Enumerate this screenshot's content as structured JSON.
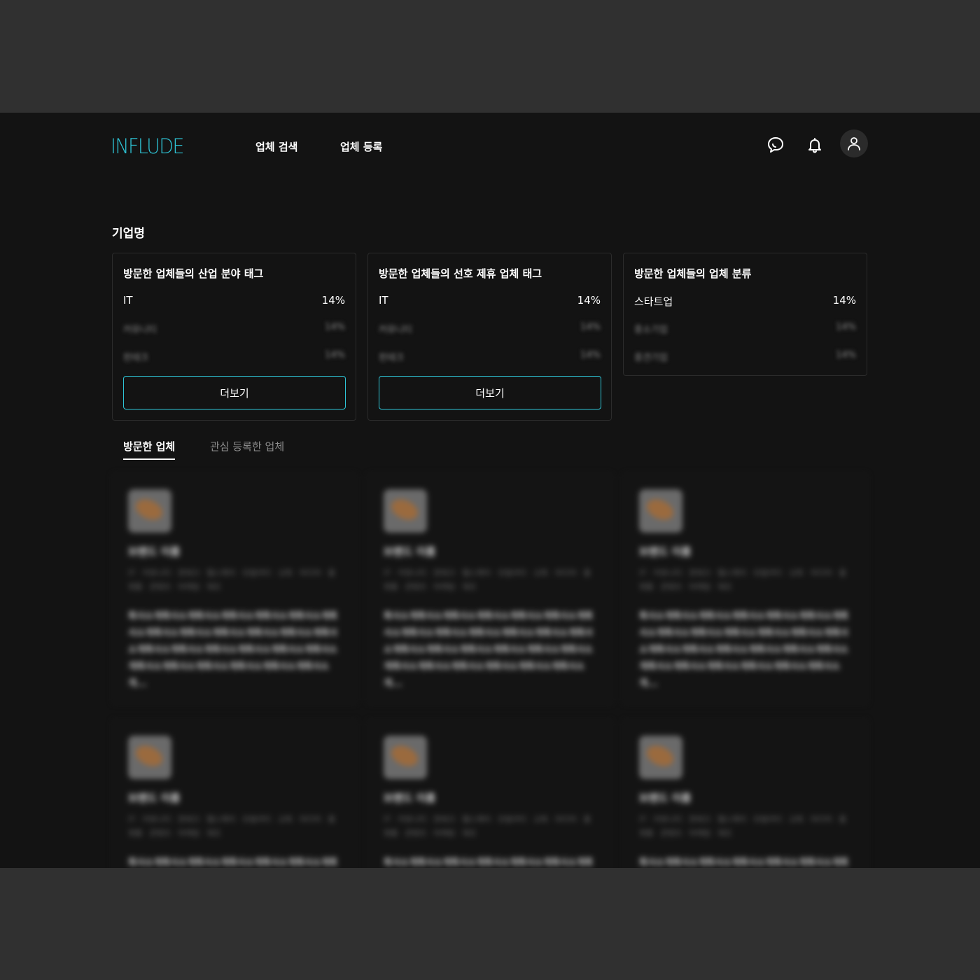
{
  "header": {
    "logo": "INFLUDE",
    "nav": [
      "업체 검색",
      "업체 등록"
    ]
  },
  "company_title": "기업명",
  "stats": [
    {
      "title": "방문한 업체들의 산업 분야 태그",
      "rows": [
        {
          "label": "IT",
          "value": "14%"
        },
        {
          "label": "커뮤니티",
          "value": "14%"
        },
        {
          "label": "핀테크",
          "value": "14%"
        }
      ],
      "more": "더보기"
    },
    {
      "title": "방문한 업체들의 선호 제휴 업체 태그",
      "rows": [
        {
          "label": "IT",
          "value": "14%"
        },
        {
          "label": "커뮤니티",
          "value": "14%"
        },
        {
          "label": "핀테크",
          "value": "14%"
        }
      ],
      "more": "더보기"
    },
    {
      "title": "방문한 업체들의 업체 분류",
      "rows": [
        {
          "label": "스타트업",
          "value": "14%"
        },
        {
          "label": "중소기업",
          "value": "14%"
        },
        {
          "label": "중견기업",
          "value": "14%"
        }
      ]
    }
  ],
  "tabs": {
    "active": "방문한 업체",
    "inactive": "관심 등록한 업체"
  },
  "companies": [
    {
      "name": "브랜드 이름",
      "tags": "IT · 커뮤니티 · 핀테크 · 헬스케어 · 모빌리티 · 교육 · 미디어 · 플랫폼 · 콘텐츠 · 마케팅 · 제조",
      "desc": "회사소개회사소개회사소개회사소개회사소개회사소개회사소개회사소개회사소개회사소개회사소개회사소개회사소개회사소개회사소개회사소개회사소개회사소개회사소개회사소개회사소개회사소개회사소개회사소개회사소개..."
    },
    {
      "name": "브랜드 이름",
      "tags": "IT · 커뮤니티 · 핀테크 · 헬스케어 · 모빌리티 · 교육 · 미디어 · 플랫폼 · 콘텐츠 · 마케팅 · 제조",
      "desc": "회사소개회사소개회사소개회사소개회사소개회사소개회사소개회사소개회사소개회사소개회사소개회사소개회사소개회사소개회사소개회사소개회사소개회사소개회사소개회사소개회사소개회사소개회사소개회사소개회사소개..."
    },
    {
      "name": "브랜드 이름",
      "tags": "IT · 커뮤니티 · 핀테크 · 헬스케어 · 모빌리티 · 교육 · 미디어 · 플랫폼 · 콘텐츠 · 마케팅 · 제조",
      "desc": "회사소개회사소개회사소개회사소개회사소개회사소개회사소개회사소개회사소개회사소개회사소개회사소개회사소개회사소개회사소개회사소개회사소개회사소개회사소개회사소개회사소개회사소개회사소개회사소개회사소개..."
    },
    {
      "name": "브랜드 이름",
      "tags": "IT · 커뮤니티 · 핀테크 · 헬스케어 · 모빌리티 · 교육 · 미디어 · 플랫폼 · 콘텐츠 · 마케팅 · 제조",
      "desc": "회사소개회사소개회사소개회사소개회사소개회사소개회사소개회사소개회사소개회사소개회사소개회사소개회사소개회사소개회사소개회사소개회사소개회사소개회사소개회사소개회사소개회사소개회사소개회사소개회사소개..."
    },
    {
      "name": "브랜드 이름",
      "tags": "IT · 커뮤니티 · 핀테크 · 헬스케어 · 모빌리티 · 교육 · 미디어 · 플랫폼 · 콘텐츠 · 마케팅 · 제조",
      "desc": "회사소개회사소개회사소개회사소개회사소개회사소개회사소개회사소개회사소개회사소개회사소개회사소개회사소개회사소개회사소개회사소개회사소개회사소개회사소개회사소개회사소개회사소개회사소개회사소개회사소개..."
    },
    {
      "name": "브랜드 이름",
      "tags": "IT · 커뮤니티 · 핀테크 · 헬스케어 · 모빌리티 · 교육 · 미디어 · 플랫폼 · 콘텐츠 · 마케팅 · 제조",
      "desc": "회사소개회사소개회사소개회사소개회사소개회사소개회사소개회사소개회사소개회사소개회사소개회사소개회사소개회사소개회사소개회사소개회사소개회사소개회사소개회사소개회사소개회사소개회사소개회사소개회사소개..."
    }
  ],
  "colors": {
    "accent": "#2ec4d6",
    "background": "#131313",
    "backdrop": "#303030"
  },
  "icons": {
    "chat": "chat-bubble-icon",
    "bell": "bell-icon",
    "user": "user-icon"
  }
}
